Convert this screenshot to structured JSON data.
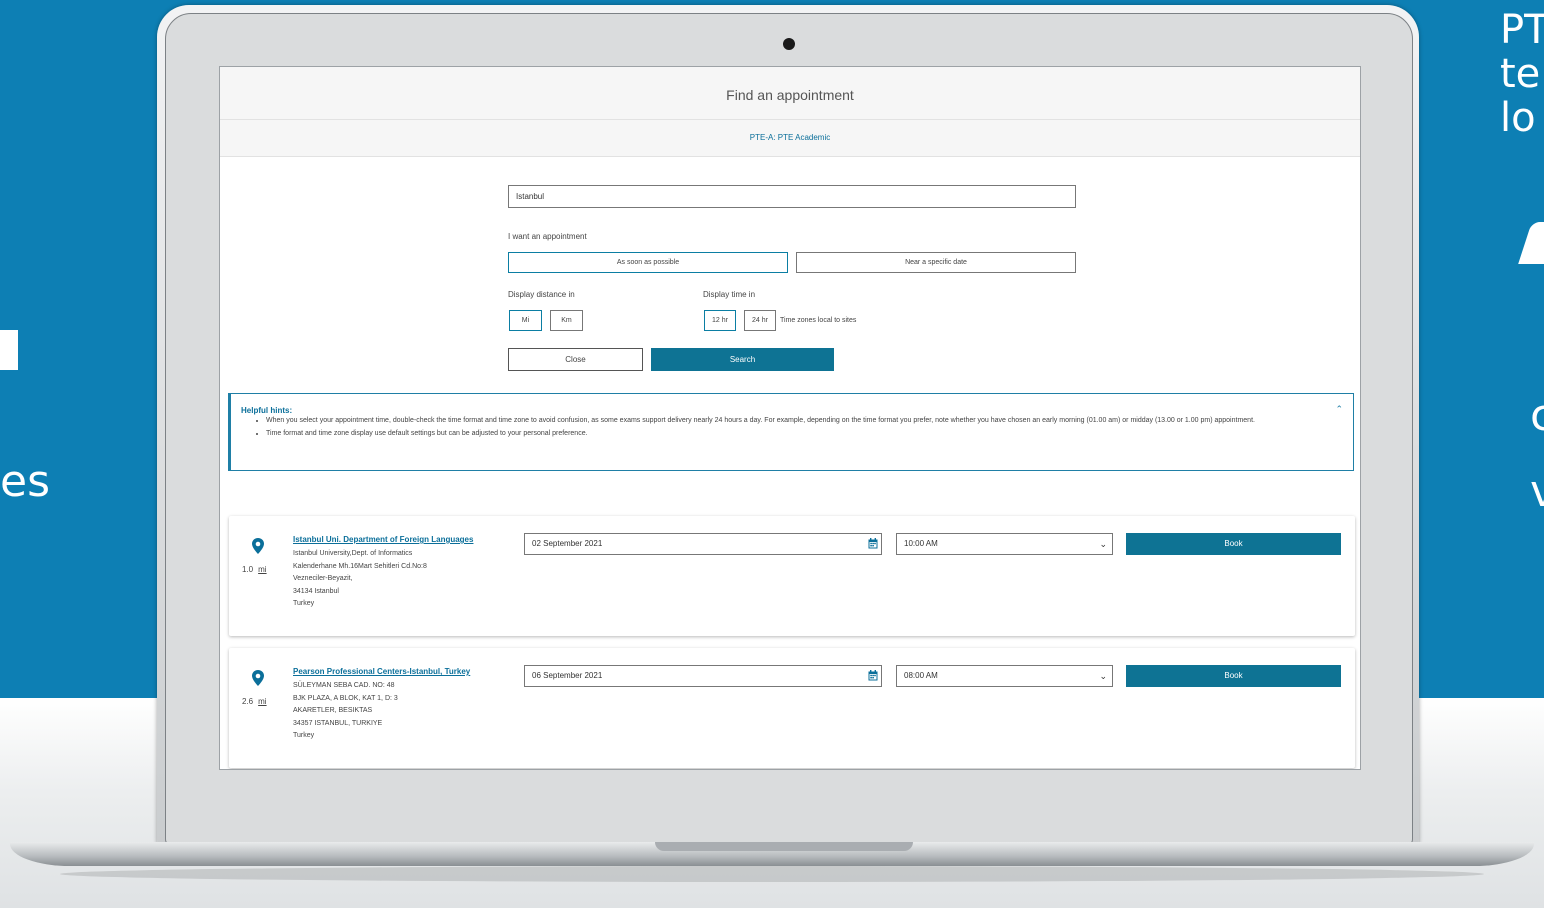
{
  "background": {
    "left_text": "es",
    "right_text_top": "PT\nte\nlo",
    "right_text_mid": "c",
    "right_text_low": "v"
  },
  "page": {
    "title": "Find an appointment",
    "exam": "PTE-A: PTE Academic"
  },
  "search": {
    "location": "Istanbul",
    "appointment_label": "I want an appointment",
    "asap_label": "As soon as possible",
    "near_date_label": "Near a specific date",
    "distance_label": "Display distance in",
    "mi_label": "Mi",
    "km_label": "Km",
    "time_label": "Display time in",
    "hr12_label": "12 hr",
    "hr24_label": "24 hr",
    "tz_note": "Time zones local to sites",
    "close_label": "Close",
    "search_label": "Search"
  },
  "hints": {
    "title": "Helpful hints:",
    "items": [
      "When you select your appointment time, double-check the time format and time zone to avoid confusion, as some exams support delivery nearly 24 hours a day. For example, depending on the time format you prefer, note whether you have chosen an early morning (01.00 am) or midday (13.00 or 1.00 pm) appointment.",
      "Time format and time zone display use default settings but can be adjusted to your personal preference."
    ]
  },
  "results": [
    {
      "name": "Istanbul Uni. Department of Foreign Languages",
      "address": [
        "Istanbul University,Dept. of Informatics",
        "Kalenderhane Mh.16Mart Sehitleri Cd.No:8",
        "Vezneciler-Beyazit,",
        "34134 Istanbul",
        "Turkey"
      ],
      "distance": "1.0",
      "unit": "mi",
      "date": "02 September 2021",
      "time": "10:00 AM",
      "book_label": "Book"
    },
    {
      "name": "Pearson Professional Centers-Istanbul, Turkey",
      "address": [
        "SÜLEYMAN SEBA CAD. NO: 48",
        "BJK PLAZA, A BLOK, KAT 1, D: 3",
        "AKARETLER, BESIKTAS",
        "34357 ISTANBUL, TURKIYE",
        "Turkey"
      ],
      "distance": "2.6",
      "unit": "mi",
      "date": "06 September 2021",
      "time": "08:00 AM",
      "book_label": "Book"
    }
  ],
  "colors": {
    "background_blue": "#0d7fb4",
    "primary_button": "#0e7394",
    "link": "#0b6f9a"
  }
}
